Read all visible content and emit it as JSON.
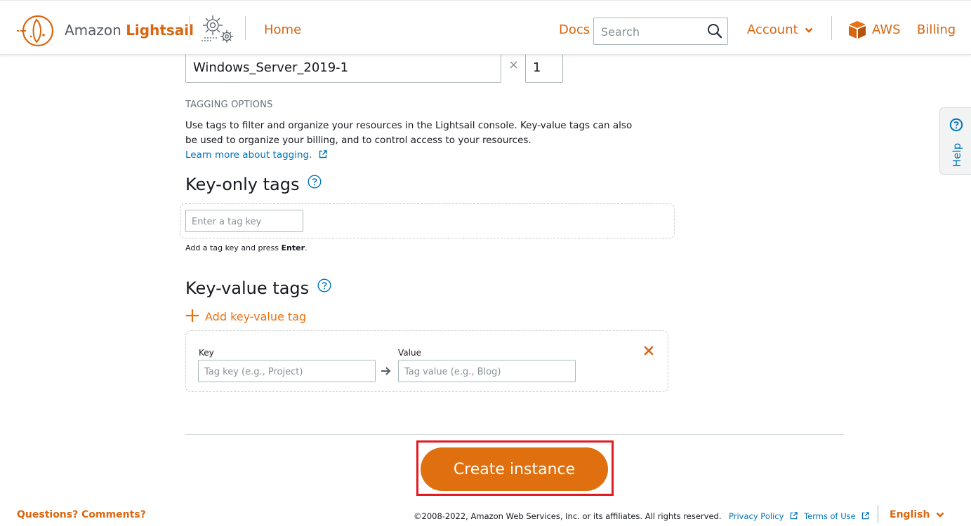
{
  "header": {
    "logo_prefix": "Amazon ",
    "logo_brand": "Lightsail",
    "home": "Home",
    "docs": "Docs",
    "search_placeholder": "Search",
    "account": "Account",
    "aws": "AWS",
    "billing": "Billing"
  },
  "instance": {
    "name_value": "Windows_Server_2019-1",
    "times": "×",
    "count_value": "1"
  },
  "tagging": {
    "section_label": "TAGGING OPTIONS",
    "description": "Use tags to filter and organize your resources in the Lightsail console. Key-value tags can also be used to organize your billing, and to control access to your resources.",
    "learn_more": "Learn more about tagging.",
    "key_only_heading": "Key-only tags",
    "tag_key_placeholder": "Enter a tag key",
    "hint_prefix": "Add a tag key and press ",
    "hint_key": "Enter",
    "hint_suffix": ".",
    "key_value_heading": "Key-value tags",
    "add_kv_label": "Add key-value tag",
    "kv_key_label": "Key",
    "kv_value_label": "Value",
    "kv_key_placeholder": "Tag key (e.g., Project)",
    "kv_value_placeholder": "Tag value (e.g., Blog)"
  },
  "actions": {
    "create_instance": "Create instance"
  },
  "help_tab": {
    "label": "Help"
  },
  "footer": {
    "questions": "Questions? Comments?",
    "copyright": "©2008-2022, Amazon Web Services, Inc. or its affiliates. All rights reserved.",
    "privacy": "Privacy Policy",
    "terms": "Terms of Use",
    "language": "English"
  },
  "colors": {
    "brand_orange": "#d9660f",
    "accent_orange": "#ec7211",
    "button_orange": "#e0700f",
    "link_blue": "#0073bb",
    "highlight_red": "#e01b22"
  },
  "icons": {
    "logo": "lightsail-logo-icon",
    "settings": "gear-icon",
    "search": "search-icon",
    "account_chevron": "chevron-down-icon",
    "aws": "aws-box-icon",
    "external_link": "external-link-icon",
    "help": "question-circle-icon",
    "add": "plus-icon",
    "arrow": "arrow-right-icon",
    "remove": "close-icon"
  }
}
